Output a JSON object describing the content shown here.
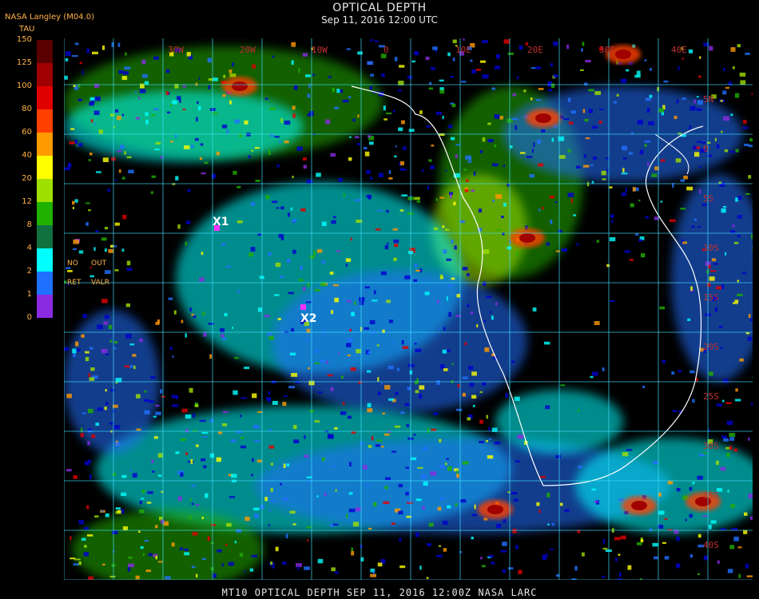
{
  "header": {
    "title": "OPTICAL DEPTH",
    "subtitle": "Sep 11, 2016 12:00 UTC",
    "producer": "NASA Langley (M04.0)"
  },
  "legend": {
    "title": "TAU",
    "ticks": [
      "150",
      "125",
      "100",
      "80",
      "60",
      "40",
      "20",
      "12",
      "8",
      "4",
      "2",
      "1",
      "0"
    ],
    "colors": [
      "#5a0000",
      "#a00000",
      "#e00000",
      "#ff4000",
      "#ff9a00",
      "#ffff00",
      "#a0e000",
      "#20b000",
      "#107040",
      "#00ffff",
      "#2070ff",
      "#0000d0",
      "#8a2be2"
    ],
    "note_row1": [
      "NO",
      "OUT"
    ],
    "note_row2": [
      "RET",
      "VALR"
    ]
  },
  "map": {
    "markers": [
      {
        "label": "X1",
        "color": "#ff33ff"
      },
      {
        "label": "X2",
        "color": "#ff33ff"
      }
    ],
    "grid_labels_top": [
      "30W",
      "20W",
      "10W",
      "0",
      "10E",
      "20E",
      "30E",
      "40E"
    ],
    "grid_labels_right": [
      "5N",
      "0",
      "5S",
      "10S",
      "15S",
      "20S",
      "25S",
      "30S",
      "35S",
      "40S"
    ],
    "grid_color": "#40e0ff",
    "coast_color": "#ffffff"
  },
  "footer": {
    "text": "MT10   OPTICAL DEPTH    SEP 11, 2016 12:00Z    NASA LARC"
  }
}
